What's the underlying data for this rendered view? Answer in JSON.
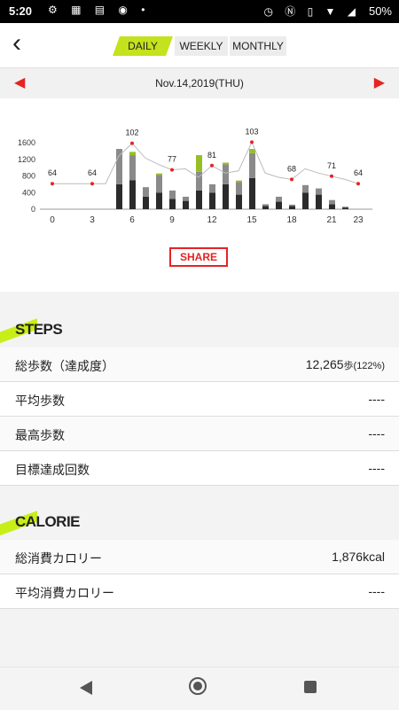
{
  "status": {
    "time": "5:20",
    "battery": "50%"
  },
  "tabs": {
    "daily": "DAILY",
    "weekly": "WEEKLY",
    "monthly": "MONTHLY"
  },
  "date": "Nov.14,2019(THU)",
  "share": "SHARE",
  "colors": {
    "accent": "#c4e21e",
    "red": "#e52323",
    "dark_bar": "#2b2b2b",
    "grey_bar": "#8a8a8a",
    "green_bar": "#96bf25"
  },
  "chart_data": {
    "type": "bar",
    "yticks": [
      "1600",
      "1200",
      "800",
      "400",
      "0"
    ],
    "xticks": [
      "0",
      "3",
      "6",
      "9",
      "12",
      "15",
      "18",
      "21",
      "23"
    ],
    "ylim": [
      0,
      1600
    ],
    "steps": [
      {
        "hour": 5,
        "dark": 600,
        "grey": 850,
        "green": 0
      },
      {
        "hour": 6,
        "dark": 700,
        "grey": 600,
        "green": 80
      },
      {
        "hour": 7,
        "dark": 300,
        "grey": 230,
        "green": 0
      },
      {
        "hour": 8,
        "dark": 400,
        "grey": 420,
        "green": 40
      },
      {
        "hour": 9,
        "dark": 250,
        "grey": 200,
        "green": 0
      },
      {
        "hour": 10,
        "dark": 200,
        "grey": 100,
        "green": 0
      },
      {
        "hour": 11,
        "dark": 450,
        "grey": 450,
        "green": 400
      },
      {
        "hour": 12,
        "dark": 400,
        "grey": 200,
        "green": 0
      },
      {
        "hour": 13,
        "dark": 600,
        "grey": 480,
        "green": 40
      },
      {
        "hour": 14,
        "dark": 350,
        "grey": 300,
        "green": 40
      },
      {
        "hour": 15,
        "dark": 750,
        "grey": 600,
        "green": 100
      },
      {
        "hour": 16,
        "dark": 80,
        "grey": 40,
        "green": 0
      },
      {
        "hour": 17,
        "dark": 180,
        "grey": 120,
        "green": 0
      },
      {
        "hour": 18,
        "dark": 80,
        "grey": 30,
        "green": 0
      },
      {
        "hour": 19,
        "dark": 400,
        "grey": 180,
        "green": 0
      },
      {
        "hour": 20,
        "dark": 350,
        "grey": 150,
        "green": 0
      },
      {
        "hour": 21,
        "dark": 120,
        "grey": 100,
        "green": 0
      },
      {
        "hour": 22,
        "dark": 40,
        "grey": 20,
        "green": 0
      }
    ],
    "heart_rate": [
      {
        "hour": 0,
        "value": 64,
        "label": "64"
      },
      {
        "hour": 1,
        "value": 64
      },
      {
        "hour": 2,
        "value": 64
      },
      {
        "hour": 3,
        "value": 64,
        "label": "64"
      },
      {
        "hour": 4,
        "value": 64
      },
      {
        "hour": 5,
        "value": 90
      },
      {
        "hour": 6,
        "value": 102,
        "label": "102"
      },
      {
        "hour": 7,
        "value": 88
      },
      {
        "hour": 8,
        "value": 82
      },
      {
        "hour": 9,
        "value": 77,
        "label": "77"
      },
      {
        "hour": 10,
        "value": 78
      },
      {
        "hour": 11,
        "value": 70
      },
      {
        "hour": 12,
        "value": 81,
        "label": "81"
      },
      {
        "hour": 13,
        "value": 74
      },
      {
        "hour": 14,
        "value": 76
      },
      {
        "hour": 15,
        "value": 103,
        "label": "103"
      },
      {
        "hour": 16,
        "value": 74
      },
      {
        "hour": 17,
        "value": 70
      },
      {
        "hour": 18,
        "value": 68,
        "label": "68"
      },
      {
        "hour": 19,
        "value": 78
      },
      {
        "hour": 20,
        "value": 74
      },
      {
        "hour": 21,
        "value": 71,
        "label": "71"
      },
      {
        "hour": 22,
        "value": 68
      },
      {
        "hour": 23,
        "value": 64,
        "label": "64"
      }
    ]
  },
  "steps_section": {
    "title": "STEPS",
    "rows": [
      {
        "label": "総歩数（達成度）",
        "value": "12,265",
        "unit": "歩",
        "extra": "(122%)"
      },
      {
        "label": "平均歩数",
        "value": "----"
      },
      {
        "label": "最高歩数",
        "value": "----"
      },
      {
        "label": "目標達成回数",
        "value": "----"
      }
    ]
  },
  "calorie_section": {
    "title": "CALORIE",
    "rows": [
      {
        "label": "総消費カロリー",
        "value": "1,876kcal"
      },
      {
        "label": "平均消費カロリー",
        "value": "----"
      }
    ]
  }
}
